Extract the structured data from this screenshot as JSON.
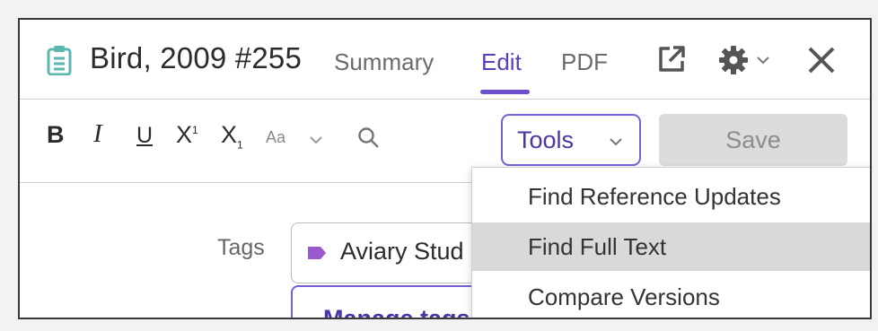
{
  "header": {
    "title": "Bird, 2009 #255",
    "tabs": [
      {
        "label": "Summary",
        "active": false
      },
      {
        "label": "Edit",
        "active": true
      },
      {
        "label": "PDF",
        "active": false
      }
    ],
    "icons": [
      "clipboard-icon",
      "open-external-icon",
      "gear-icon",
      "chevron-down-icon",
      "close-icon"
    ]
  },
  "toolbar": {
    "bold": "B",
    "italic": "I",
    "underline": "U",
    "superscript": {
      "base": "X",
      "mark": "1"
    },
    "subscript": {
      "base": "X",
      "mark": "1"
    },
    "text_case": "Aa",
    "tools_label": "Tools",
    "save_label": "Save"
  },
  "fields": {
    "tags_label": "Tags",
    "tag_value": "Aviary Stud",
    "manage_tags_label": "Manage tags"
  },
  "tools_menu": {
    "items": [
      {
        "label": "Find Reference Updates"
      },
      {
        "label": "Find Full Text",
        "highlighted": true
      },
      {
        "label": "Compare Versions"
      }
    ]
  },
  "colors": {
    "accent": "#6c4ed1",
    "accent_text": "#4a34a6",
    "clipboard_icon": "#5bb7b0",
    "tag_marker": "#9b59d0",
    "menu_highlight": "#d9d9d9",
    "save_disabled_bg": "#dcdcdc"
  }
}
